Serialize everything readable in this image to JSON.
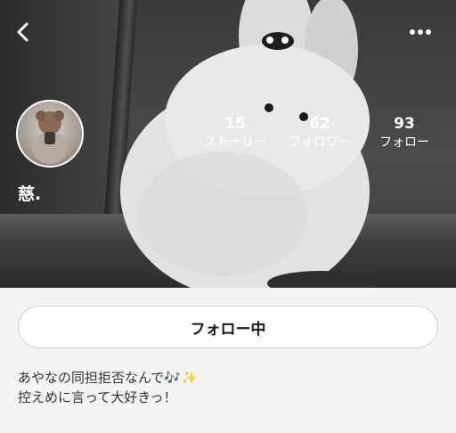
{
  "nav": {
    "back_icon": "chevron-left-icon",
    "more_icon": "more-dots-icon"
  },
  "profile": {
    "name": "慈.",
    "stats": [
      {
        "value": "15",
        "label": "ストーリー"
      },
      {
        "value": "62",
        "label": "フォロワー"
      },
      {
        "value": "93",
        "label": "フォロー"
      }
    ]
  },
  "actions": {
    "follow_label": "フォロー中"
  },
  "bio": {
    "line1": "あやなの同担拒否なんで",
    "line1_emoji": "🎶✨",
    "line2": "控えめに言って大好きっ！"
  },
  "colors": {
    "background": "#f4f4f4",
    "button_border": "#cfcfcf",
    "cover_text": "#ffffff"
  }
}
